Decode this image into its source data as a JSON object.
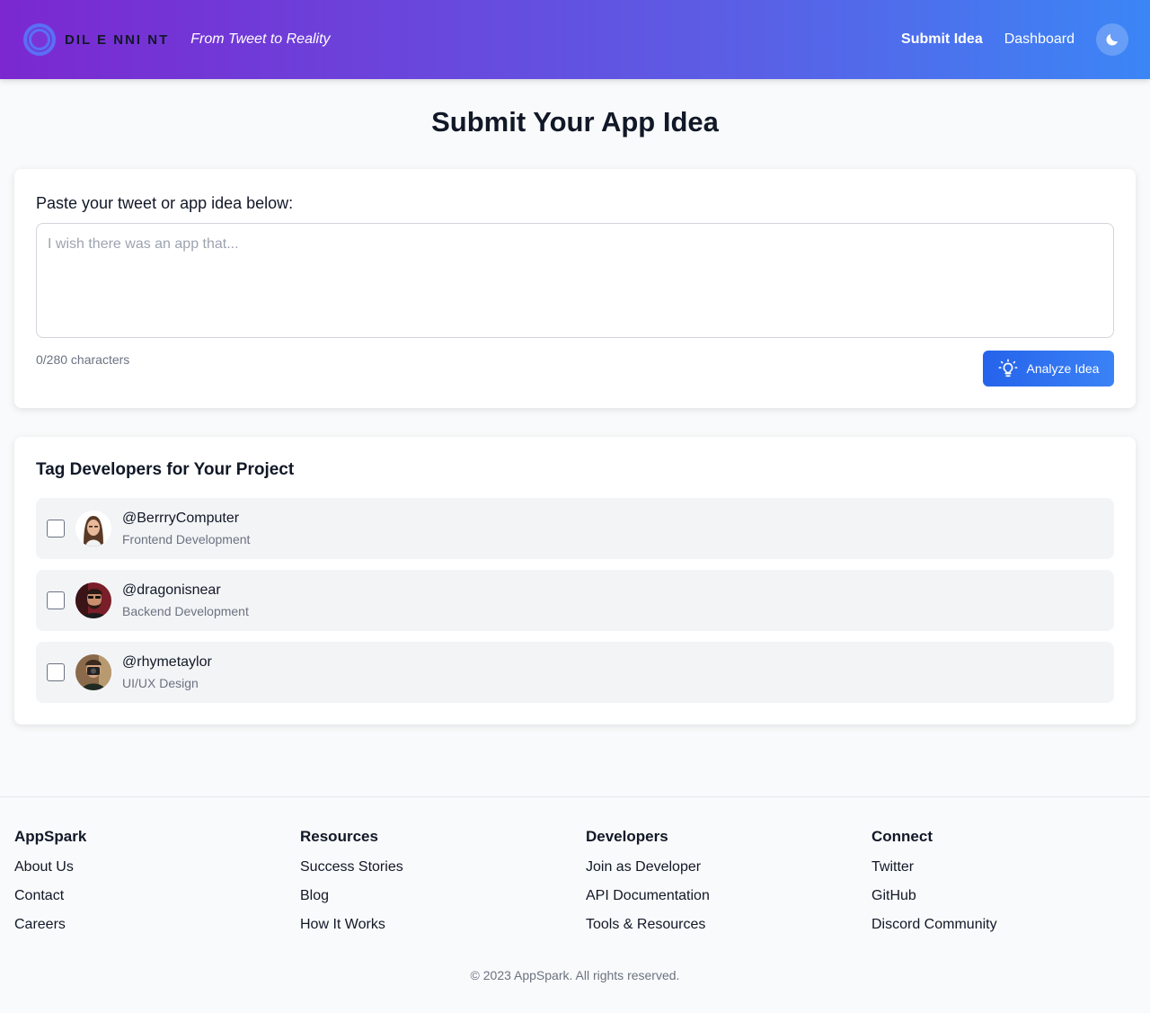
{
  "header": {
    "brand_name": "DIL E NNI NT",
    "tagline": "From Tweet to Reality",
    "nav": {
      "submit_idea": "Submit Idea",
      "dashboard": "Dashboard"
    },
    "theme_icon": "moon-icon"
  },
  "main": {
    "title": "Submit Your App Idea",
    "idea_form": {
      "label": "Paste your tweet or app idea below:",
      "placeholder": "I wish there was an app that...",
      "value": "",
      "char_count": "0/280 characters",
      "analyze_label": "Analyze Idea",
      "analyze_icon": "lightbulb-icon"
    },
    "tag_section": {
      "title": "Tag Developers for Your Project",
      "developers": [
        {
          "handle": "@BerrryComputer",
          "role": "Frontend Development",
          "checked": false
        },
        {
          "handle": "@dragonisnear",
          "role": "Backend Development",
          "checked": false
        },
        {
          "handle": "@rhymetaylor",
          "role": "UI/UX Design",
          "checked": false
        }
      ]
    }
  },
  "footer": {
    "columns": [
      {
        "heading": "AppSpark",
        "links": [
          "About Us",
          "Contact",
          "Careers"
        ]
      },
      {
        "heading": "Resources",
        "links": [
          "Success Stories",
          "Blog",
          "How It Works"
        ]
      },
      {
        "heading": "Developers",
        "links": [
          "Join as Developer",
          "API Documentation",
          "Tools & Resources"
        ]
      },
      {
        "heading": "Connect",
        "links": [
          "Twitter",
          "GitHub",
          "Discord Community"
        ]
      }
    ],
    "copyright": "© 2023 AppSpark. All rights reserved."
  },
  "colors": {
    "header_start": "#7b28d0",
    "header_end": "#3b86f6",
    "accent": "#2563eb"
  }
}
